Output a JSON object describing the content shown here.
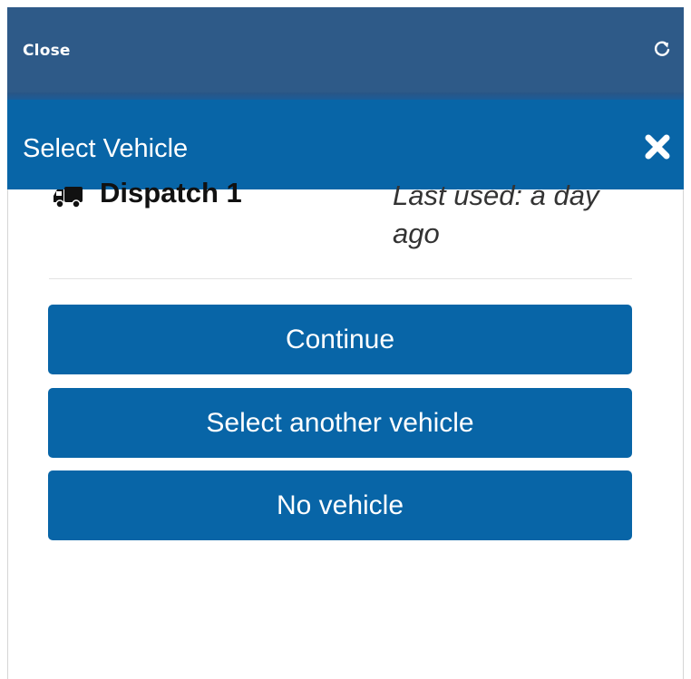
{
  "topbar": {
    "close_label": "Close",
    "refresh_icon": "refresh-icon"
  },
  "modal": {
    "title": "Select Vehicle",
    "close_icon": "close-x-icon"
  },
  "vehicle": {
    "icon": "truck-icon",
    "name": "Dispatch 1",
    "last_used": "Last used: a day ago"
  },
  "buttons": {
    "continue": "Continue",
    "select_another": "Select another vehicle",
    "no_vehicle": "No vehicle"
  },
  "colors": {
    "topbar_bg": "#2e5a88",
    "accent": "#0865a7",
    "text_dark": "#111111"
  }
}
